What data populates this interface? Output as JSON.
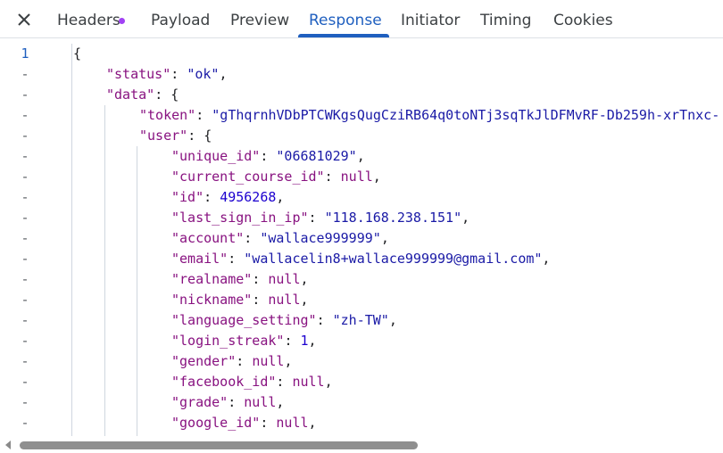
{
  "tabs": {
    "close_icon": "close-icon",
    "headers": "Headers",
    "payload": "Payload",
    "preview": "Preview",
    "response": "Response",
    "initiator": "Initiator",
    "timing": "Timing",
    "cookies": "Cookies",
    "active": "Response",
    "headers_dot_color": "#a142f4",
    "accent_color": "#1f5fbf"
  },
  "code": {
    "lines": [
      {
        "gutter": "1",
        "text": "{"
      },
      {
        "gutter": "-",
        "key": "\"status\"",
        "value": "\"ok\"",
        "value_type": "string",
        "trail": ","
      },
      {
        "gutter": "-",
        "key": "\"data\"",
        "value": "{",
        "value_type": "punct",
        "trail": ""
      },
      {
        "gutter": "-",
        "key": "\"token\"",
        "value": "\"gThqrnhVDbPTCWKgsQugCziRB64q0toNTj3sqTkJlDFMvRF-Db259h-xrTnxc-",
        "value_type": "string",
        "trail": ""
      },
      {
        "gutter": "-",
        "key": "\"user\"",
        "value": "{",
        "value_type": "punct",
        "trail": ""
      },
      {
        "gutter": "-",
        "key": "\"unique_id\"",
        "value": "\"06681029\"",
        "value_type": "string",
        "trail": ","
      },
      {
        "gutter": "-",
        "key": "\"current_course_id\"",
        "value": "null",
        "value_type": "null",
        "trail": ","
      },
      {
        "gutter": "-",
        "key": "\"id\"",
        "value": "4956268",
        "value_type": "number",
        "trail": ","
      },
      {
        "gutter": "-",
        "key": "\"last_sign_in_ip\"",
        "value": "\"118.168.238.151\"",
        "value_type": "string",
        "trail": ","
      },
      {
        "gutter": "-",
        "key": "\"account\"",
        "value": "\"wallace999999\"",
        "value_type": "string",
        "trail": ","
      },
      {
        "gutter": "-",
        "key": "\"email\"",
        "value": "\"wallacelin8+wallace999999@gmail.com\"",
        "value_type": "string",
        "trail": ","
      },
      {
        "gutter": "-",
        "key": "\"realname\"",
        "value": "null",
        "value_type": "null",
        "trail": ","
      },
      {
        "gutter": "-",
        "key": "\"nickname\"",
        "value": "null",
        "value_type": "null",
        "trail": ","
      },
      {
        "gutter": "-",
        "key": "\"language_setting\"",
        "value": "\"zh-TW\"",
        "value_type": "string",
        "trail": ","
      },
      {
        "gutter": "-",
        "key": "\"login_streak\"",
        "value": "1",
        "value_type": "number",
        "trail": ","
      },
      {
        "gutter": "-",
        "key": "\"gender\"",
        "value": "null",
        "value_type": "null",
        "trail": ","
      },
      {
        "gutter": "-",
        "key": "\"facebook_id\"",
        "value": "null",
        "value_type": "null",
        "trail": ","
      },
      {
        "gutter": "-",
        "key": "\"grade\"",
        "value": "null",
        "value_type": "null",
        "trail": ","
      },
      {
        "gutter": "-",
        "key": "\"google_id\"",
        "value": "null",
        "value_type": "null",
        "trail": ","
      }
    ]
  },
  "colors": {
    "key": "#881280",
    "string": "#1a1aa6",
    "number": "#1c00cf",
    "null": "#881280",
    "line_number": "#1f5fbf",
    "gutter_dash": "#5f6368"
  }
}
